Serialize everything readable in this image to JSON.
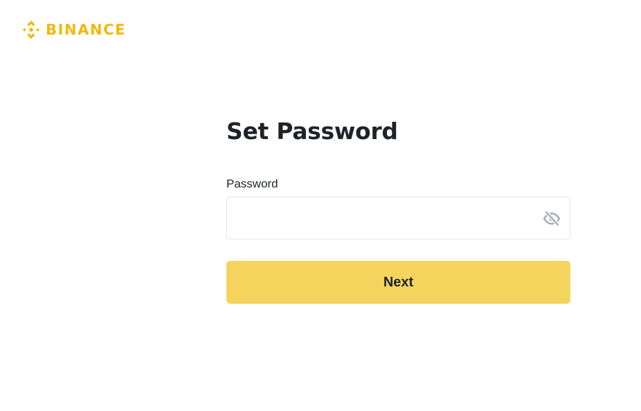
{
  "brand": {
    "name": "BINANCE",
    "color": "#F0B90B",
    "logo_icon": "binance-diamond-icon"
  },
  "form": {
    "title": "Set Password",
    "password_label": "Password",
    "password_value": "",
    "visibility_icon": "eye-slash-icon",
    "next_label": "Next",
    "next_button_color": "#F5D45E"
  }
}
